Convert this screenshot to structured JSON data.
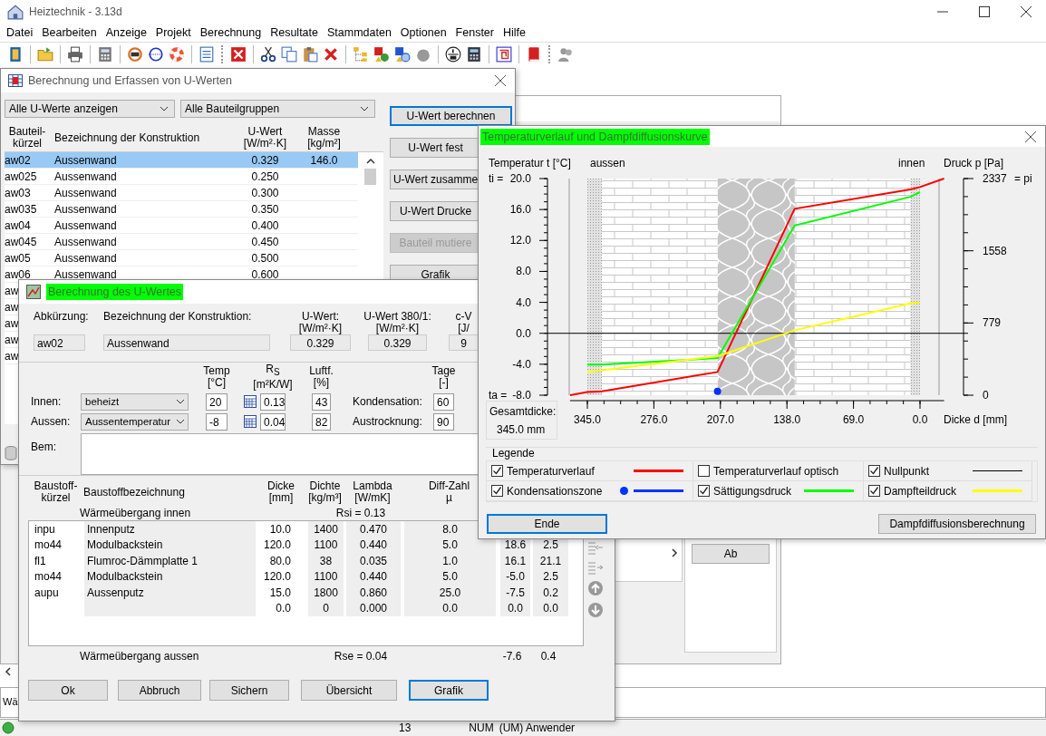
{
  "app": {
    "title": "Heiztechnik - 3.13d"
  },
  "menu": [
    "Datei",
    "Bearbeiten",
    "Anzeige",
    "Projekt",
    "Berechnung",
    "Resultate",
    "Stammdaten",
    "Optionen",
    "Fenster",
    "Hilfe"
  ],
  "u_values_window": {
    "title": "Berechnung und Erfassen von U-Werten",
    "filter": "Alle U-Werte anzeigen",
    "group": "Alle Bauteilgruppen",
    "columns": [
      {
        "lines": [
          "Bauteil-",
          "kürzel"
        ]
      },
      {
        "lines": [
          "Bezeichnung der Konstruktion"
        ]
      },
      {
        "lines": [
          "U-Wert",
          "[W/m²·K]"
        ]
      },
      {
        "lines": [
          "Masse",
          "[kg/m²]"
        ]
      }
    ],
    "rows": [
      {
        "code": "aw02",
        "name": "Aussenwand",
        "u_value": "0.329",
        "mass": "146.0",
        "selected": true
      },
      {
        "code": "aw025",
        "name": "Aussenwand",
        "u_value": "0.250",
        "selected": false
      },
      {
        "code": "aw03",
        "name": "Aussenwand",
        "u_value": "0.300",
        "selected": false
      },
      {
        "code": "aw035",
        "name": "Aussenwand",
        "u_value": "0.350",
        "selected": false
      },
      {
        "code": "aw04",
        "name": "Aussenwand",
        "u_value": "0.400",
        "selected": false
      },
      {
        "code": "aw045",
        "name": "Aussenwand",
        "u_value": "0.450",
        "selected": false
      },
      {
        "code": "aw05",
        "name": "Aussenwand",
        "u_value": "0.500",
        "selected": false
      },
      {
        "code": "aw06",
        "name": "Aussenwand",
        "u_value": "0.600",
        "selected": false
      },
      {
        "code": "aw",
        "selected": false
      },
      {
        "code": "aw",
        "selected": false
      },
      {
        "code": "aw",
        "selected": false
      },
      {
        "code": "aw",
        "selected": false
      },
      {
        "code": "aw",
        "selected": false
      }
    ],
    "buttons": [
      {
        "label": "U-Wert berechnen",
        "disabled": false,
        "default": true
      },
      {
        "label": "U-Wert fest",
        "disabled": false,
        "default": false
      },
      {
        "label": "U-Wert zusamme",
        "disabled": false,
        "default": false
      },
      {
        "label": "U-Wert Drucke",
        "disabled": false,
        "default": false
      },
      {
        "label": "Bauteil mutiere",
        "disabled": true,
        "default": false
      },
      {
        "label": "Grafik",
        "disabled": false,
        "default": false
      }
    ]
  },
  "u_value_dialog": {
    "title": "Berechnung des U-Wertes",
    "header_fields": [
      {
        "lines": [
          "Abkürzung:"
        ],
        "value": "aw02"
      },
      {
        "lines": [
          "Bezeichnung der Konstruktion:"
        ],
        "value": "Aussenwand"
      },
      {
        "lines": [
          "U-Wert:",
          "[W/m²·K]"
        ],
        "value": "0.329"
      },
      {
        "lines": [
          "U-Wert 380/1:",
          "[W/m²·K]"
        ],
        "value": "0.329"
      },
      {
        "lines": [
          "c-V",
          "[J/"
        ],
        "value": "9"
      }
    ],
    "condition_headers": [
      {
        "lines": [
          "Temp",
          "[°C]"
        ]
      },
      {
        "lines": [
          "R$_{S}$",
          "[m²K/W]"
        ]
      },
      {
        "lines": [
          "Luftf.",
          "[%]"
        ]
      },
      {
        "lines": [
          "Tage",
          "[-]"
        ]
      }
    ],
    "conditions": [
      {
        "label": "Innen:",
        "mode": "beheizt",
        "temp": "20",
        "rs": "0.13",
        "humidity": "43",
        "phase": "Kondensation:",
        "days": "60"
      },
      {
        "label": "Aussen:",
        "mode": "Aussentemperatur",
        "temp": "-8",
        "rs": "0.04",
        "humidity": "82",
        "phase": "Austrocknung:",
        "days": "90"
      }
    ],
    "remark_label": "Bem:",
    "material_columns": [
      {
        "lines": [
          "Baustoff-",
          "kürzel"
        ]
      },
      {
        "lines": [
          "Baustoffbezeichnung"
        ]
      },
      {
        "lines": [
          "Dicke",
          "[mm]"
        ]
      },
      {
        "lines": [
          "Dichte",
          "[kg/m³]"
        ]
      },
      {
        "lines": [
          "Lambda",
          "[W/mK]"
        ]
      },
      {
        "lines": [
          "Diff-Zahl",
          "µ"
        ]
      }
    ],
    "inner_transfer": {
      "label": "Wärmeübergang innen",
      "value": "Rsi = 0.13"
    },
    "materials": [
      {
        "code": "inpu",
        "name": "Innenputz",
        "thickness": "10.0",
        "density": "1400",
        "lambda": "0.470",
        "mu": "8.0",
        "kind": "plaster"
      },
      {
        "code": "mo44",
        "name": "Modulbackstein",
        "thickness": "120.0",
        "density": "1100",
        "lambda": "0.440",
        "mu": "5.0",
        "column_7": "18.6",
        "column_8": "2.5",
        "kind": "brick"
      },
      {
        "code": "fl1",
        "name": "Flumroc-Dämmplatte 1",
        "thickness": "80.0",
        "density": "38",
        "lambda": "0.035",
        "mu": "1.0",
        "column_7": "16.1",
        "column_8": "21.1",
        "kind": "insulation"
      },
      {
        "code": "mo44",
        "name": "Modulbackstein",
        "thickness": "120.0",
        "density": "1100",
        "lambda": "0.440",
        "mu": "5.0",
        "column_7": "-5.0",
        "column_8": "2.5",
        "kind": "brick"
      },
      {
        "code": "aupu",
        "name": "Aussenputz",
        "thickness": "15.0",
        "density": "1800",
        "lambda": "0.860",
        "mu": "25.0",
        "column_7": "-7.5",
        "column_8": "0.2",
        "kind": "plaster"
      },
      {
        "thickness": "0.0",
        "density": "0",
        "lambda": "0.000",
        "mu": "0.0",
        "column_7": "0.0",
        "column_8": "0.0",
        "kind": "none"
      }
    ],
    "outer_transfer": {
      "label": "Wärmeübergang aussen",
      "value": "Rse = 0.04",
      "column_7": "-7.6",
      "column_8": "0.4"
    },
    "buttons": [
      {
        "label": "Ok",
        "default": false
      },
      {
        "label": "Abbruch",
        "default": false
      },
      {
        "label": "Sichern",
        "default": false
      },
      {
        "label": "Übersicht",
        "default": false
      },
      {
        "label": "Grafik",
        "default": true
      }
    ]
  },
  "chart_window": {
    "title": "Temperaturverlauf und Dampfdiffusionskurve",
    "side_labels": {
      "outside": "aussen",
      "inside": "innen"
    },
    "temp_bound_labels": {
      "inside": "ti =",
      "outside": "ta ="
    },
    "pressure_bound_label": "= pi",
    "total_thickness": {
      "label": "Gesamtdicke:",
      "value": "345.0  mm"
    },
    "chart_data": {
      "type": "line",
      "xlabel": "Dicke d [mm]",
      "ylabel": "Temperatur t [°C]",
      "y2label": "Druck p [Pa]",
      "x": [
        363,
        345,
        330,
        210,
        130,
        10,
        0,
        -25
      ],
      "xlim": [
        363,
        -25
      ],
      "ylim": [
        -8,
        20
      ],
      "y2lim": [
        0,
        2337
      ],
      "xticks": [
        {
          "value": 345,
          "label": "345.0"
        },
        {
          "value": 276,
          "label": "276.0"
        },
        {
          "value": 207,
          "label": "207.0"
        },
        {
          "value": 138,
          "label": "138.0"
        },
        {
          "value": 69,
          "label": "69.0"
        },
        {
          "value": 0,
          "label": "0.0"
        }
      ],
      "yticks": [
        {
          "value": 20,
          "label": "20.0"
        },
        {
          "value": 16,
          "label": "16.0"
        },
        {
          "value": 12,
          "label": "12.0"
        },
        {
          "value": 8,
          "label": "8.0"
        },
        {
          "value": 4,
          "label": "4.0"
        },
        {
          "value": 0,
          "label": "0.0"
        },
        {
          "value": -4,
          "label": "-4.0"
        },
        {
          "value": -8,
          "label": "-8.0"
        }
      ],
      "y2ticks": [
        2337,
        1558,
        779,
        0
      ],
      "series": [
        {
          "color": "#ff0000",
          "values": [
            -8,
            -7.6,
            -7.5,
            -5.0,
            16.1,
            18.6,
            18.9,
            20
          ]
        },
        {
          "color": "#00ff00",
          "axis": "y2",
          "values": [
            null,
            330,
            330,
            400,
            1830,
            2140,
            2190,
            null
          ]
        },
        {
          "color": "#ffff00",
          "axis": "y2",
          "values": [
            null,
            250,
            270,
            420,
            700,
            990,
            1000,
            null
          ]
        },
        {
          "color": "#0033ff",
          "marker": "o",
          "values": [
            null,
            null,
            null,
            -7.5,
            null,
            null,
            null,
            null
          ]
        }
      ]
    },
    "legend": {
      "title": "Legende",
      "items": [
        {
          "label": "Temperaturverlauf",
          "checked": true,
          "kind": "line",
          "color": "#ff0000"
        },
        {
          "label": "Temperaturverlauf optisch",
          "checked": false,
          "kind": "none"
        },
        {
          "label": "Nullpunkt",
          "checked": true,
          "kind": "thin_line",
          "color": "#000000"
        },
        {
          "label": "Kondensationszone",
          "checked": true,
          "kind": "dot_line",
          "color": "#0033ff"
        },
        {
          "label": "Sättigungsdruck",
          "checked": true,
          "kind": "line",
          "color": "#00ff00"
        },
        {
          "label": "Dampfteildruck",
          "checked": true,
          "kind": "line",
          "color": "#ffff00"
        }
      ]
    },
    "buttons": [
      {
        "label": "Ende",
        "default": true
      },
      {
        "label": "Dampfdiffusionsberechnung",
        "default": false
      }
    ]
  },
  "background_window": {
    "button": "Ab"
  },
  "note_field": {
    "value": "Wä"
  },
  "status_bar": [
    "13",
    "NUM",
    "(UM) Anwender"
  ]
}
